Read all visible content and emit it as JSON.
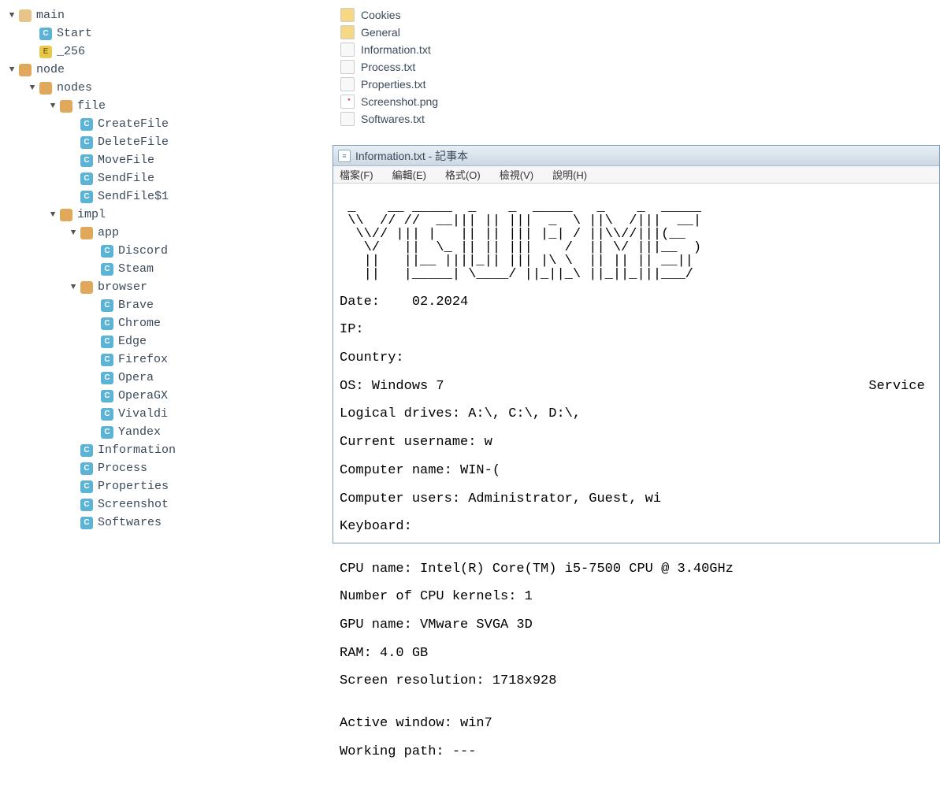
{
  "tree": [
    {
      "indent": 0,
      "toggle": "▼",
      "icon": "folder-main",
      "label": "main"
    },
    {
      "indent": 1,
      "toggle": "",
      "icon": "c",
      "label": "Start"
    },
    {
      "indent": 1,
      "toggle": "",
      "icon": "e",
      "label": "_256"
    },
    {
      "indent": 0,
      "toggle": "▼",
      "icon": "folder",
      "label": "node"
    },
    {
      "indent": 1,
      "toggle": "▼",
      "icon": "folder",
      "label": "nodes"
    },
    {
      "indent": 2,
      "toggle": "▼",
      "icon": "folder",
      "label": "file"
    },
    {
      "indent": 3,
      "toggle": "",
      "icon": "c",
      "label": "CreateFile"
    },
    {
      "indent": 3,
      "toggle": "",
      "icon": "c",
      "label": "DeleteFile"
    },
    {
      "indent": 3,
      "toggle": "",
      "icon": "c",
      "label": "MoveFile"
    },
    {
      "indent": 3,
      "toggle": "",
      "icon": "c",
      "label": "SendFile"
    },
    {
      "indent": 3,
      "toggle": "",
      "icon": "c",
      "label": "SendFile$1"
    },
    {
      "indent": 2,
      "toggle": "▼",
      "icon": "folder",
      "label": "impl"
    },
    {
      "indent": 3,
      "toggle": "▼",
      "icon": "folder",
      "label": "app"
    },
    {
      "indent": 4,
      "toggle": "",
      "icon": "c",
      "label": "Discord"
    },
    {
      "indent": 4,
      "toggle": "",
      "icon": "c",
      "label": "Steam"
    },
    {
      "indent": 3,
      "toggle": "▼",
      "icon": "folder",
      "label": "browser"
    },
    {
      "indent": 4,
      "toggle": "",
      "icon": "c",
      "label": "Brave"
    },
    {
      "indent": 4,
      "toggle": "",
      "icon": "c",
      "label": "Chrome"
    },
    {
      "indent": 4,
      "toggle": "",
      "icon": "c",
      "label": "Edge"
    },
    {
      "indent": 4,
      "toggle": "",
      "icon": "c",
      "label": "Firefox"
    },
    {
      "indent": 4,
      "toggle": "",
      "icon": "c",
      "label": "Opera"
    },
    {
      "indent": 4,
      "toggle": "",
      "icon": "c",
      "label": "OperaGX"
    },
    {
      "indent": 4,
      "toggle": "",
      "icon": "c",
      "label": "Vivaldi"
    },
    {
      "indent": 4,
      "toggle": "",
      "icon": "c",
      "label": "Yandex"
    },
    {
      "indent": 3,
      "toggle": "",
      "icon": "c",
      "label": "Information"
    },
    {
      "indent": 3,
      "toggle": "",
      "icon": "c",
      "label": "Process"
    },
    {
      "indent": 3,
      "toggle": "",
      "icon": "c",
      "label": "Properties"
    },
    {
      "indent": 3,
      "toggle": "",
      "icon": "c",
      "label": "Screenshot"
    },
    {
      "indent": 3,
      "toggle": "",
      "icon": "c",
      "label": "Softwares"
    }
  ],
  "files": [
    {
      "icon": "folder",
      "label": "Cookies"
    },
    {
      "icon": "folder",
      "label": "General"
    },
    {
      "icon": "txt",
      "label": "Information.txt"
    },
    {
      "icon": "txt",
      "label": "Process.txt"
    },
    {
      "icon": "txt",
      "label": "Properties.txt"
    },
    {
      "icon": "img",
      "label": "Screenshot.png"
    },
    {
      "icon": "txt",
      "label": "Softwares.txt"
    }
  ],
  "notepad": {
    "title": "Information.txt - 記事本",
    "menu": [
      {
        "label": "檔案(F)"
      },
      {
        "label": "編輯(E)"
      },
      {
        "label": "格式(O)"
      },
      {
        "label": "檢視(V)"
      },
      {
        "label": "說明(H)"
      }
    ],
    "ascii": " _    __ _____  _    _  _____   _    _  _____\n \\\\  // //  __||| || |||  _  \\ ||\\  /|||  __|\n  \\\\// ||| |   || || ||| |_| / ||\\\\//|||(__ \n   \\/   ||  \\_ || || |||    /  || \\/ |||__  )\n   ||   ||__ ||||_|| ||| |\\ \\  || || || __||\n   ||   |_____| \\____/ ||_||_\\ ||_||_|||___/\n",
    "info": {
      "date": "Date:    02.2024",
      "ip": "IP:",
      "country": "Country:",
      "os": "OS: Windows 7",
      "service_label": "Service ",
      "drives": "Logical drives: A:\\, C:\\, D:\\,",
      "username": "Current username: w",
      "computer": "Computer name: WIN-(",
      "users": "Computer users: Administrator, Guest, wi",
      "keyboard": "Keyboard:",
      "blank1": "",
      "cpu": "CPU name: Intel(R) Core(TM) i5-7500 CPU @ 3.40GHz",
      "kernels": "Number of CPU kernels: 1",
      "gpu": "GPU name: VMware SVGA 3D",
      "ram": "RAM: 4.0 GB",
      "resolution": "Screen resolution: 1718x928",
      "blank2": "",
      "active": "Active window: win7",
      "working": "Working path: ---"
    }
  }
}
